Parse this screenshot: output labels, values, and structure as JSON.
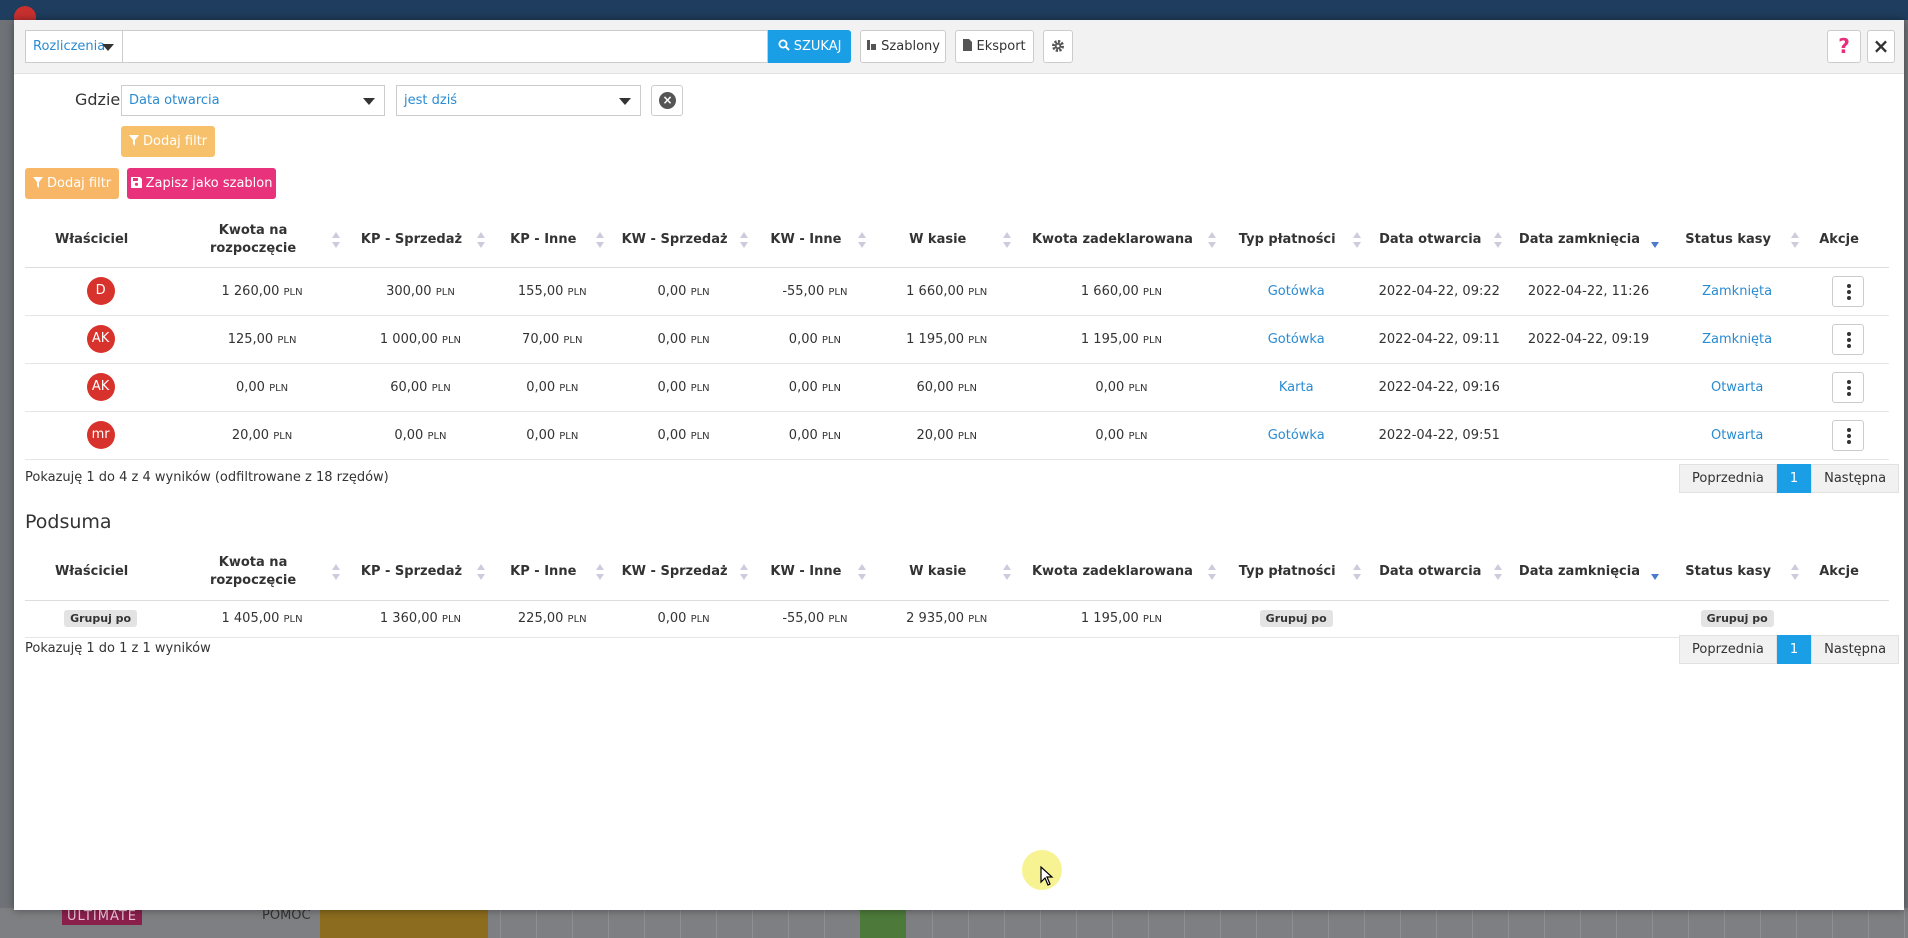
{
  "background": {
    "badge": "ULTIMATE",
    "help": "POMOC"
  },
  "toolbar": {
    "search_type": "Rozliczenia",
    "search_value": "",
    "search_button": "SZUKAJ",
    "templates_button": "Szablony",
    "export_button": "Eksport",
    "help_button": "?",
    "close_button": "×"
  },
  "filter": {
    "where_label": "Gdzie",
    "field": "Data otwarcia",
    "operator": "jest dziś",
    "add_filter_small": "Dodaj filtr",
    "add_filter": "Dodaj filtr",
    "save_template": "Zapisz jako szablon"
  },
  "columns": [
    "Właściciel",
    "Kwota na rozpoczęcie",
    "KP - Sprzedaż",
    "KP - Inne",
    "KW - Sprzedaż",
    "KW - Inne",
    "W kasie",
    "Kwota zadeklarowana",
    "Typ płatności",
    "Data otwarcia",
    "Data zamknięcia",
    "Status kasy",
    "Akcje"
  ],
  "currency": "PLN",
  "rows": [
    {
      "owner": "D",
      "start": "1 260,00",
      "kp_sale": "300,00",
      "kp_other": "155,00",
      "kw_sale": "0,00",
      "kw_other": "-55,00",
      "in_register": "1 660,00",
      "declared": "1 660,00",
      "payment": "Gotówka",
      "opened": "2022-04-22, 09:22",
      "closed": "2022-04-22, 11:26",
      "status": "Zamknięta"
    },
    {
      "owner": "AK",
      "start": "125,00",
      "kp_sale": "1 000,00",
      "kp_other": "70,00",
      "kw_sale": "0,00",
      "kw_other": "0,00",
      "in_register": "1 195,00",
      "declared": "1 195,00",
      "payment": "Gotówka",
      "opened": "2022-04-22, 09:11",
      "closed": "2022-04-22, 09:19",
      "status": "Zamknięta"
    },
    {
      "owner": "AK",
      "start": "0,00",
      "kp_sale": "60,00",
      "kp_other": "0,00",
      "kw_sale": "0,00",
      "kw_other": "0,00",
      "in_register": "60,00",
      "declared": "0,00",
      "payment": "Karta",
      "opened": "2022-04-22, 09:16",
      "closed": "",
      "status": "Otwarta"
    },
    {
      "owner": "mr",
      "start": "20,00",
      "kp_sale": "0,00",
      "kp_other": "0,00",
      "kw_sale": "0,00",
      "kw_other": "0,00",
      "in_register": "20,00",
      "declared": "0,00",
      "payment": "Gotówka",
      "opened": "2022-04-22, 09:51",
      "closed": "",
      "status": "Otwarta"
    }
  ],
  "main_info": "Pokazuję 1 do 4 z 4 wyników (odfiltrowane z 18 rzędów)",
  "pagination": {
    "prev": "Poprzednia",
    "page": "1",
    "next": "Następna"
  },
  "subtotal": {
    "title": "Podsuma",
    "group_by": "Grupuj po",
    "row": {
      "start": "1 405,00",
      "kp_sale": "1 360,00",
      "kp_other": "225,00",
      "kw_sale": "0,00",
      "kw_other": "-55,00",
      "in_register": "2 935,00",
      "declared": "1 195,00"
    },
    "info": "Pokazuję 1 do 1 z 1 wyników"
  },
  "colors": {
    "primary": "#1a9ee6",
    "pink": "#e8337c",
    "orange": "#f7b767",
    "avatar": "#d8322c",
    "link": "#2a8bd1"
  }
}
